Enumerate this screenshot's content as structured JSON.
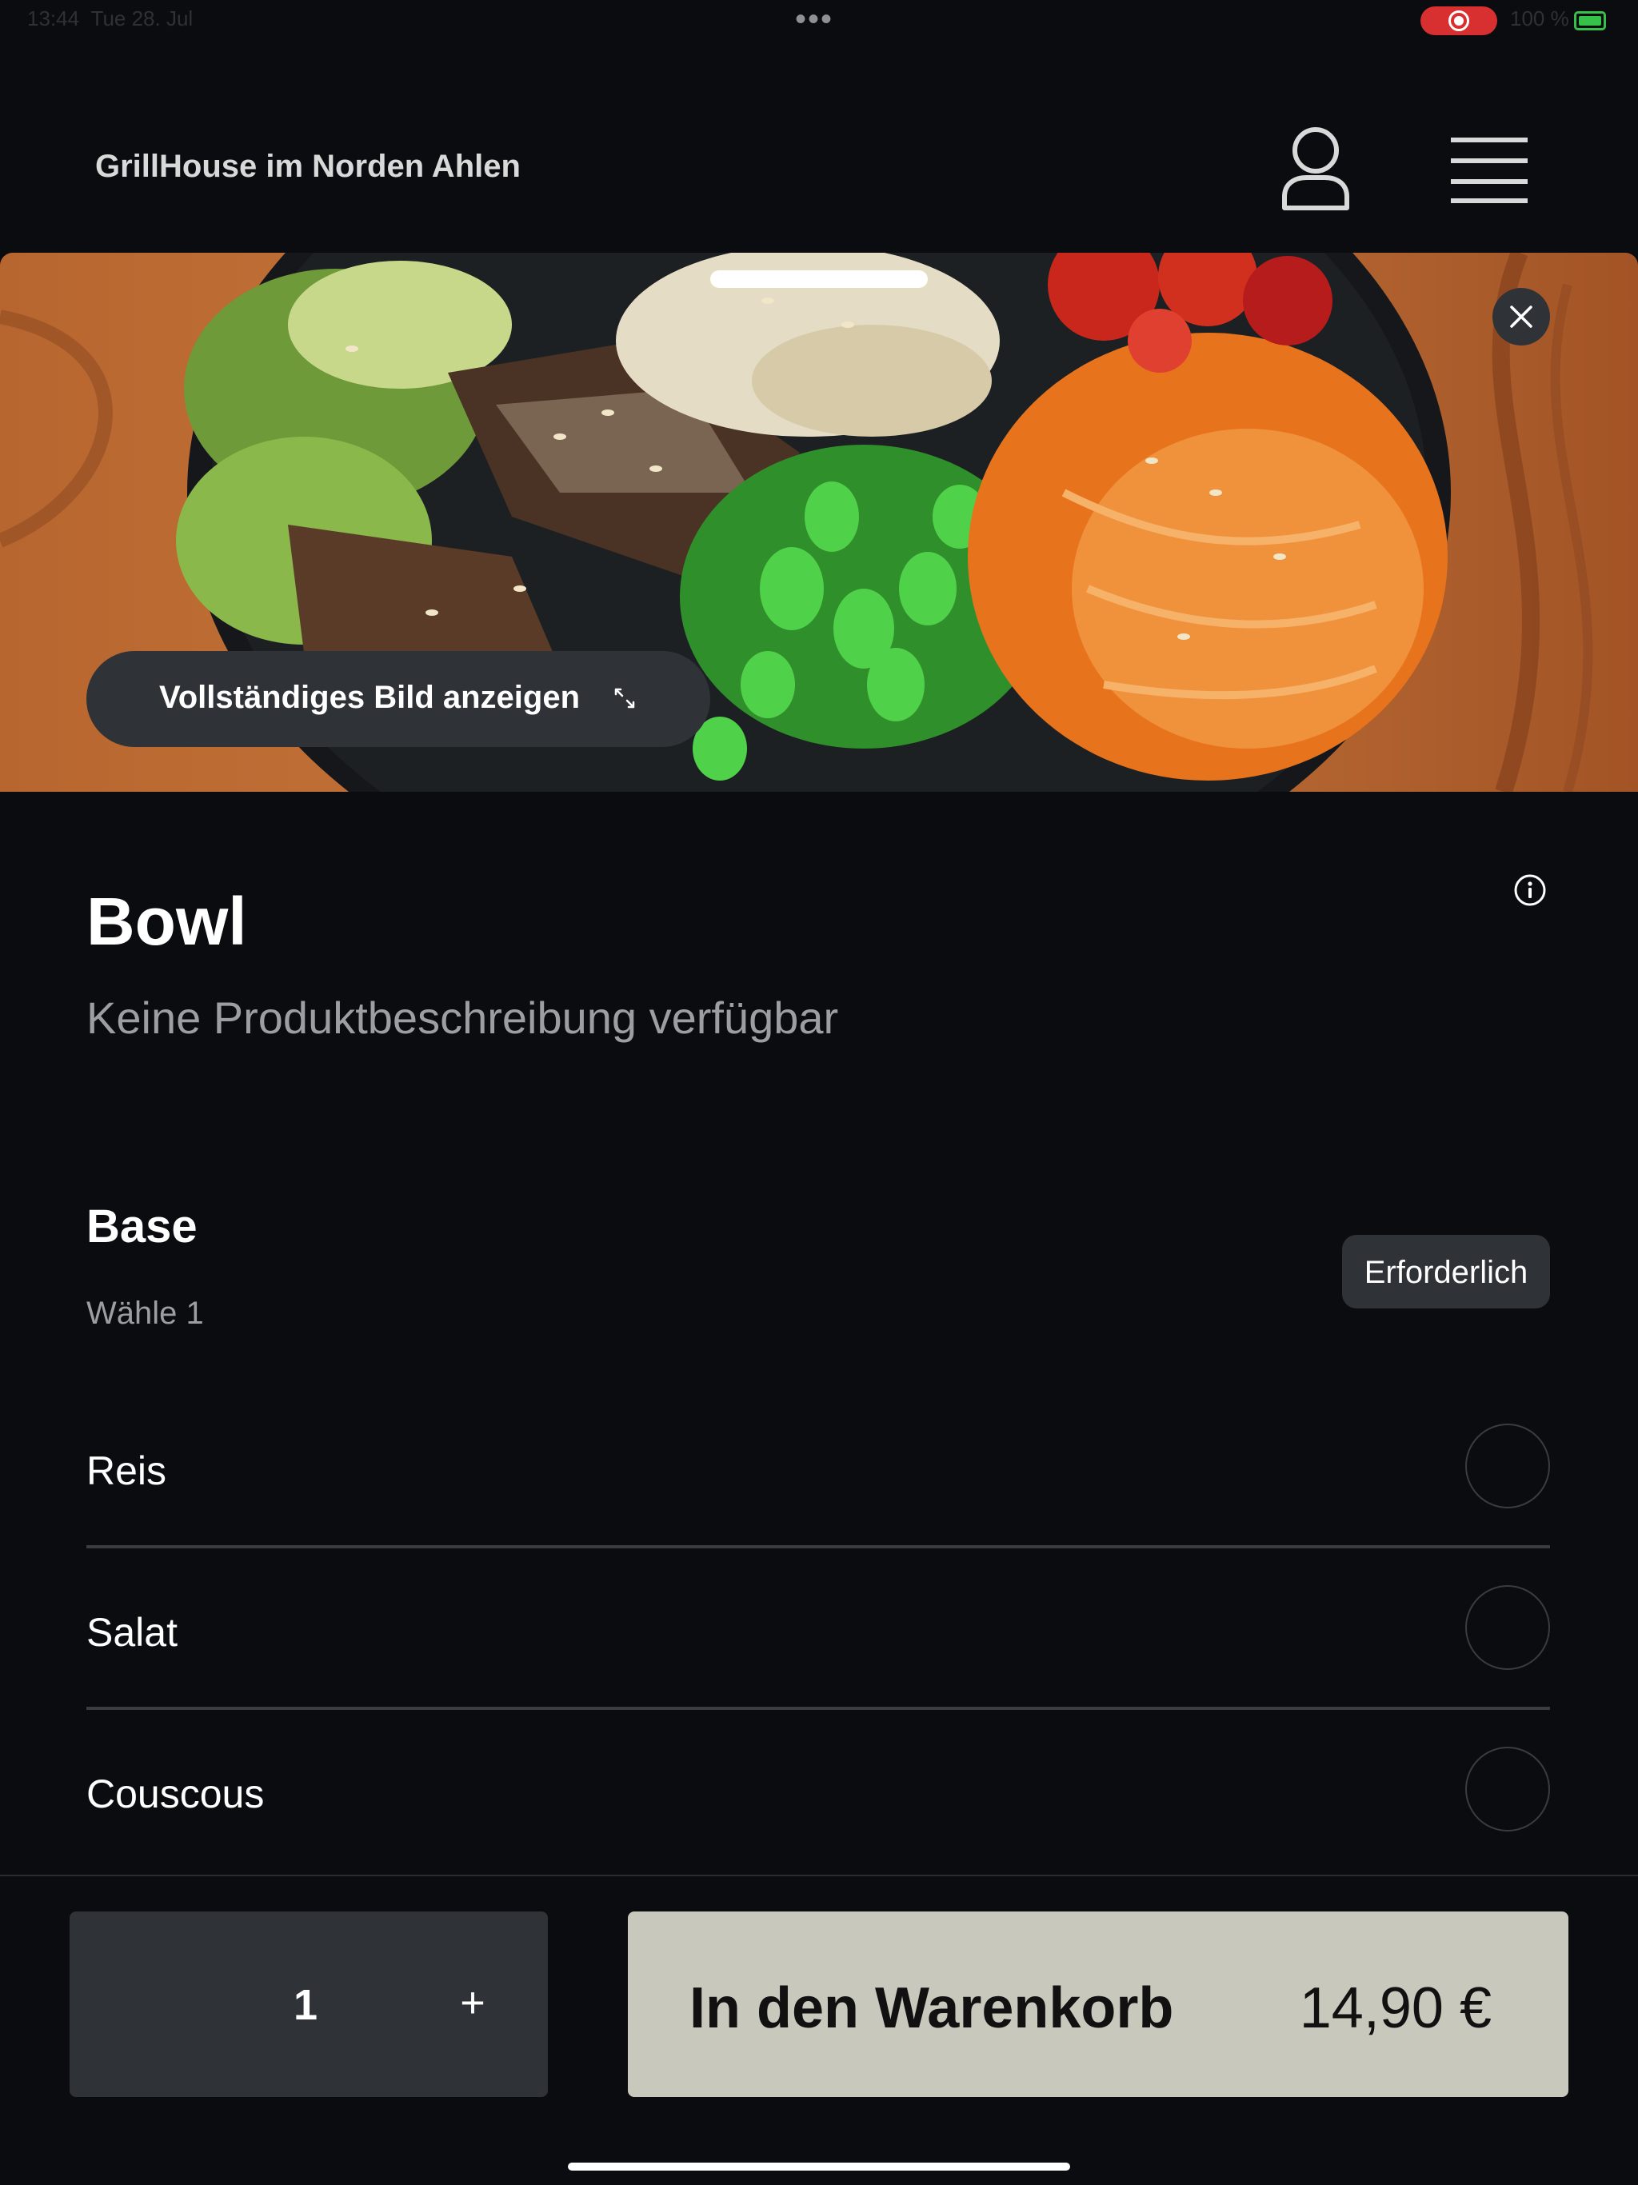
{
  "status_bar": {
    "time": "13:44",
    "date": "Tue 28. Jul",
    "battery": "100 %",
    "dots": "•••"
  },
  "header": {
    "restaurant_name": "GrillHouse im Norden Ahlen",
    "profile_icon": "user-icon",
    "menu_icon": "hamburger-menu-icon"
  },
  "hero": {
    "full_image_label": "Vollständiges Bild anzeigen",
    "close_icon": "close-icon",
    "expand_icon": "expand-icon"
  },
  "product": {
    "title": "Bowl",
    "description": "Keine Produktbeschreibung verfügbar",
    "info_icon": "info-icon"
  },
  "base_group": {
    "title": "Base",
    "subtitle": "Wähle 1",
    "required_label": "Erforderlich",
    "options": [
      {
        "label": "Reis",
        "selected": false
      },
      {
        "label": "Salat",
        "selected": false
      },
      {
        "label": "Couscous",
        "selected": false
      }
    ]
  },
  "footer": {
    "quantity": "1",
    "plus_label": "+",
    "add_to_cart_label": "In den Warenkorb",
    "price": "14,90 €"
  },
  "colors": {
    "background": "#0b0c0f",
    "surface": "#2f3236",
    "cart_button": "#c8c8bc",
    "record_indicator": "#d83030",
    "battery": "#36c24a"
  }
}
